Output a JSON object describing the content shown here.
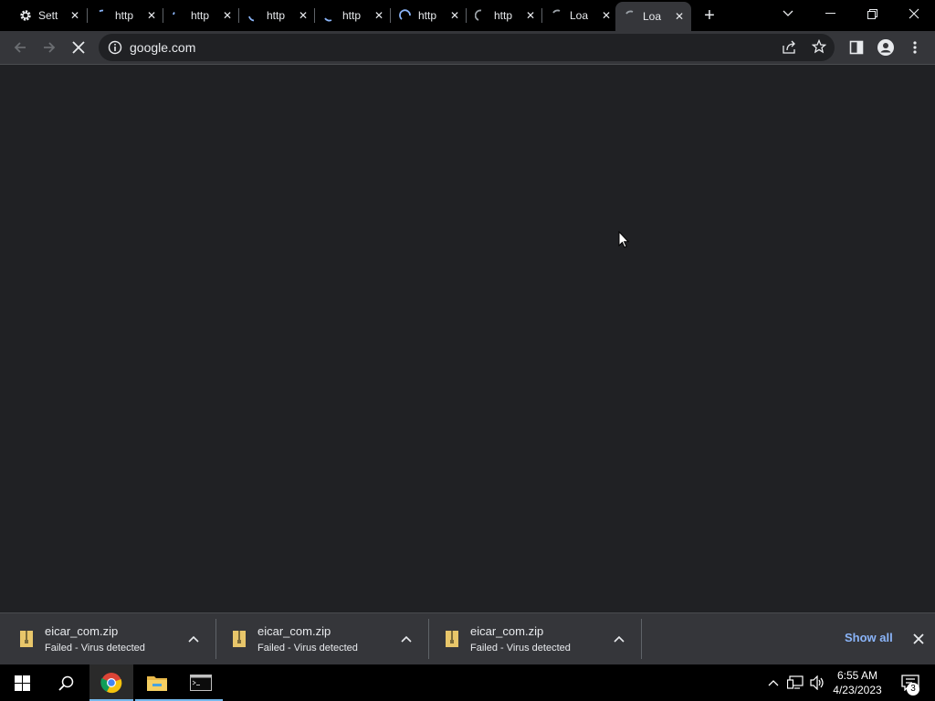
{
  "tabs": [
    {
      "title": "Sett",
      "icon": "gear-icon"
    },
    {
      "title": "http",
      "icon": "loading-spinner-icon"
    },
    {
      "title": "http",
      "icon": "loading-spinner-icon"
    },
    {
      "title": "http",
      "icon": "loading-spinner-icon"
    },
    {
      "title": "http",
      "icon": "loading-spinner-icon"
    },
    {
      "title": "http",
      "icon": "loading-spinner-icon"
    },
    {
      "title": "http",
      "icon": "loading-spinner-icon"
    },
    {
      "title": "Loa",
      "icon": "loading-spinner-icon"
    },
    {
      "title": "Loa",
      "icon": "loading-spinner-icon",
      "active": true
    }
  ],
  "address_bar": {
    "url": "google.com"
  },
  "downloads": [
    {
      "filename": "eicar_com.zip",
      "status": "Failed - Virus detected"
    },
    {
      "filename": "eicar_com.zip",
      "status": "Failed - Virus detected"
    },
    {
      "filename": "eicar_com.zip",
      "status": "Failed - Virus detected"
    }
  ],
  "download_shelf": {
    "show_all_label": "Show all"
  },
  "taskbar": {
    "time": "6:55 AM",
    "date": "4/23/2023",
    "notification_count": "3"
  },
  "colors": {
    "accent_link": "#8ab4f8",
    "toolbar": "#35363a",
    "page_bg": "#202124"
  }
}
